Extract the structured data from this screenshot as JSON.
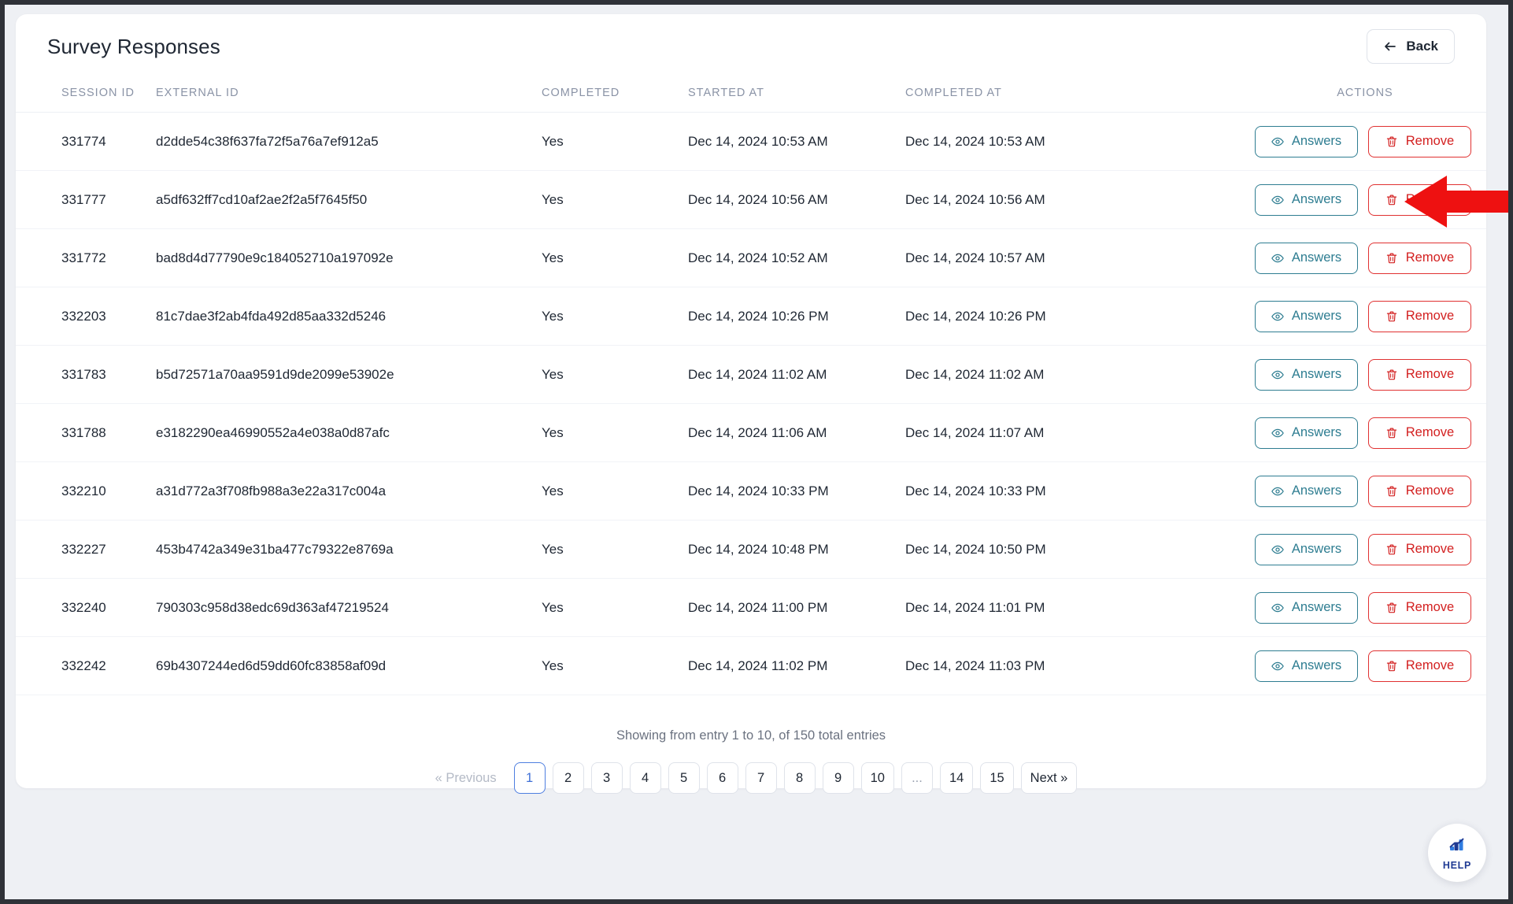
{
  "header": {
    "title": "Survey Responses",
    "back_label": "Back",
    "back_icon": "arrow-left-icon"
  },
  "table": {
    "columns": [
      "SESSION ID",
      "EXTERNAL ID",
      "COMPLETED",
      "STARTED AT",
      "COMPLETED AT",
      "ACTIONS"
    ],
    "row_actions": {
      "answers_label": "Answers",
      "answers_icon": "eye-icon",
      "remove_label": "Remove",
      "remove_icon": "trash-icon",
      "answers_color": "#2e7d91",
      "remove_color": "#d32020"
    },
    "rows": [
      {
        "session_id": "331774",
        "external_id": "d2dde54c38f637fa72f5a76a7ef912a5",
        "completed": "Yes",
        "started_at": "Dec 14, 2024 10:53 AM",
        "completed_at": "Dec 14, 2024 10:53 AM"
      },
      {
        "session_id": "331777",
        "external_id": "a5df632ff7cd10af2ae2f2a5f7645f50",
        "completed": "Yes",
        "started_at": "Dec 14, 2024 10:56 AM",
        "completed_at": "Dec 14, 2024 10:56 AM"
      },
      {
        "session_id": "331772",
        "external_id": "bad8d4d77790e9c184052710a197092e",
        "completed": "Yes",
        "started_at": "Dec 14, 2024 10:52 AM",
        "completed_at": "Dec 14, 2024 10:57 AM"
      },
      {
        "session_id": "332203",
        "external_id": "81c7dae3f2ab4fda492d85aa332d5246",
        "completed": "Yes",
        "started_at": "Dec 14, 2024 10:26 PM",
        "completed_at": "Dec 14, 2024 10:26 PM"
      },
      {
        "session_id": "331783",
        "external_id": "b5d72571a70aa9591d9de2099e53902e",
        "completed": "Yes",
        "started_at": "Dec 14, 2024 11:02 AM",
        "completed_at": "Dec 14, 2024 11:02 AM"
      },
      {
        "session_id": "331788",
        "external_id": "e3182290ea46990552a4e038a0d87afc",
        "completed": "Yes",
        "started_at": "Dec 14, 2024 11:06 AM",
        "completed_at": "Dec 14, 2024 11:07 AM"
      },
      {
        "session_id": "332210",
        "external_id": "a31d772a3f708fb988a3e22a317c004a",
        "completed": "Yes",
        "started_at": "Dec 14, 2024 10:33 PM",
        "completed_at": "Dec 14, 2024 10:33 PM"
      },
      {
        "session_id": "332227",
        "external_id": "453b4742a349e31ba477c79322e8769a",
        "completed": "Yes",
        "started_at": "Dec 14, 2024 10:48 PM",
        "completed_at": "Dec 14, 2024 10:50 PM"
      },
      {
        "session_id": "332240",
        "external_id": "790303c958d38edc69d363af47219524",
        "completed": "Yes",
        "started_at": "Dec 14, 2024 11:00 PM",
        "completed_at": "Dec 14, 2024 11:01 PM"
      },
      {
        "session_id": "332242",
        "external_id": "69b4307244ed6d59dd60fc83858af09d",
        "completed": "Yes",
        "started_at": "Dec 14, 2024 11:02 PM",
        "completed_at": "Dec 14, 2024 11:03 PM"
      }
    ]
  },
  "footer": {
    "showing_text": "Showing from entry 1 to 10, of 150 total entries",
    "pagination": {
      "previous_label": "« Previous",
      "next_label": "Next »",
      "active_page": "1",
      "pages": [
        "1",
        "2",
        "3",
        "4",
        "5",
        "6",
        "7",
        "8",
        "9",
        "10",
        "...",
        "14",
        "15"
      ]
    }
  },
  "help_widget": {
    "label": "HELP",
    "icon": "bar-chart-icon",
    "color": "#1f3a93"
  },
  "annotation": {
    "arrow_color": "#ee1111",
    "points_to": "remove-button-row-2"
  }
}
